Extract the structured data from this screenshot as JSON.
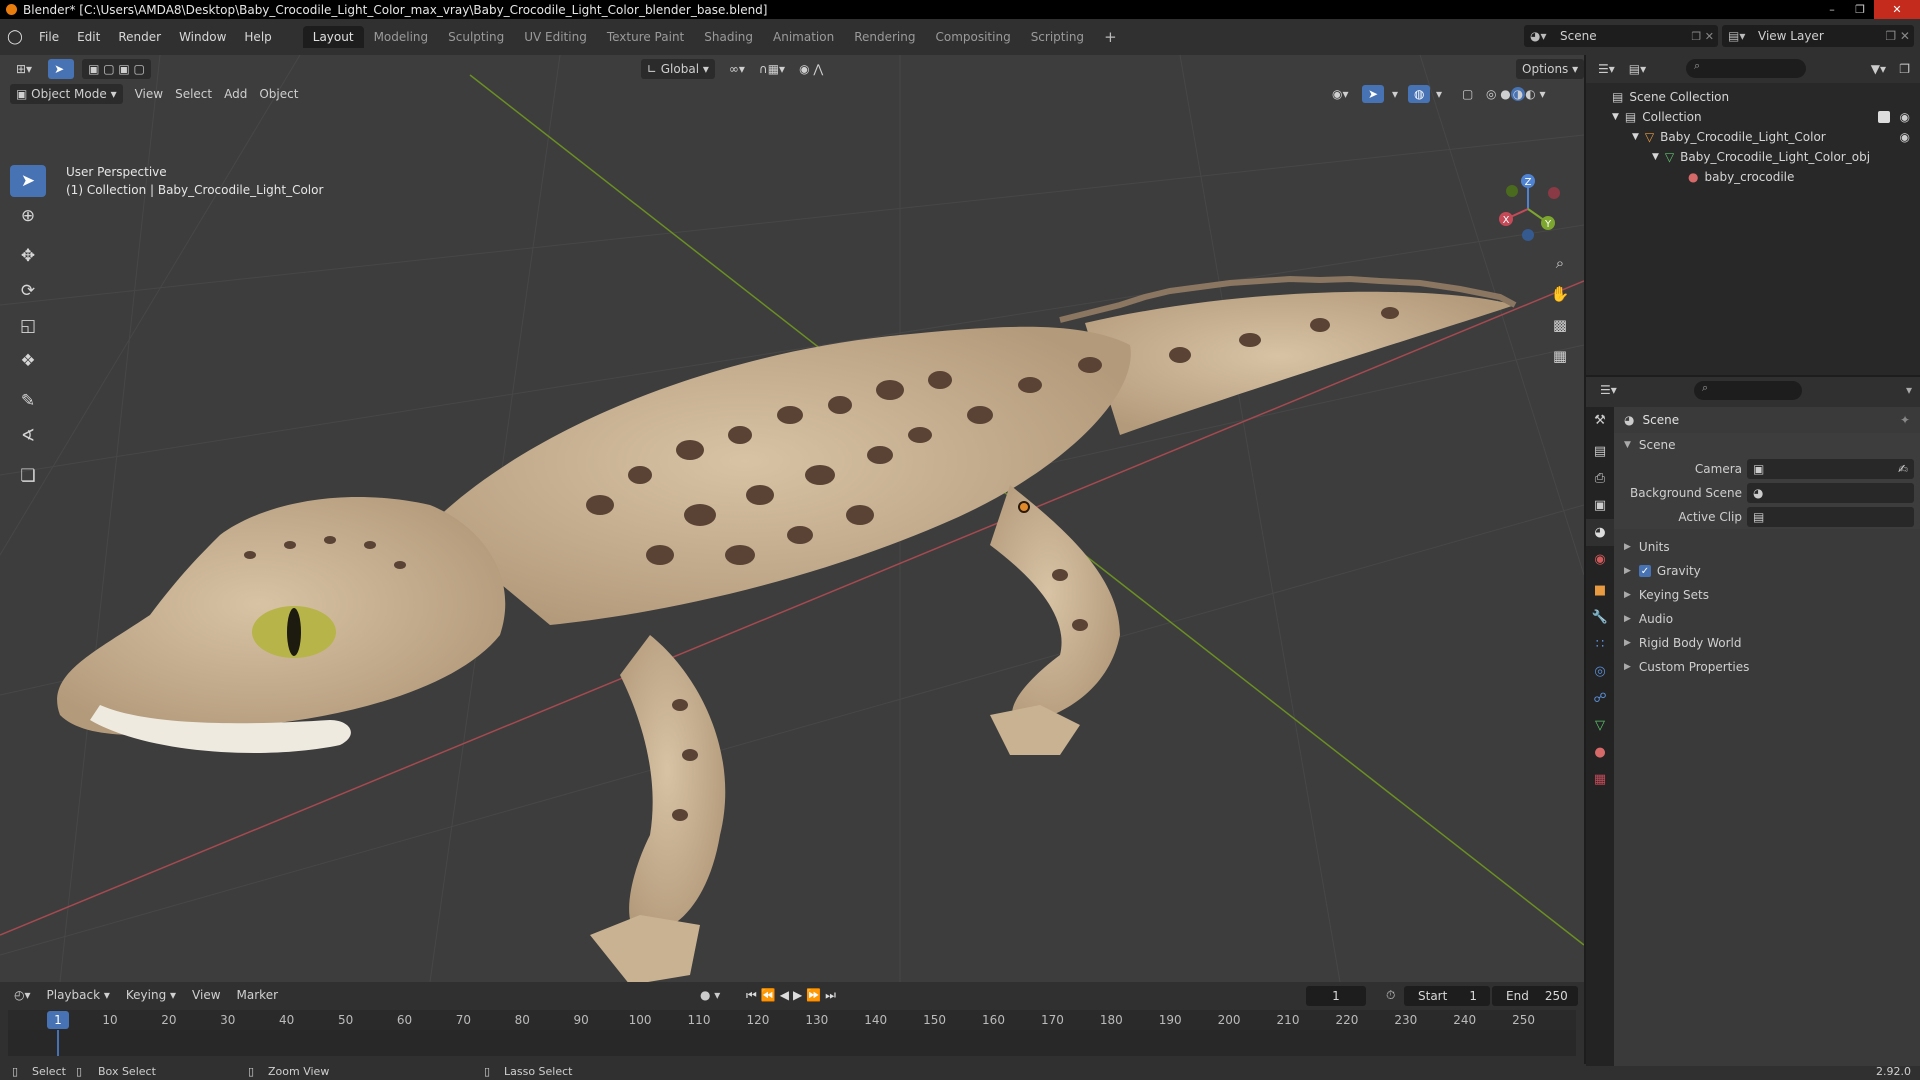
{
  "window": {
    "title": "Blender* [C:\\Users\\AMDA8\\Desktop\\Baby_Crocodile_Light_Color_max_vray\\Baby_Crocodile_Light_Color_blender_base.blend]"
  },
  "menu": {
    "file": "File",
    "edit": "Edit",
    "render": "Render",
    "window": "Window",
    "help": "Help"
  },
  "workspaces": [
    "Layout",
    "Modeling",
    "Sculpting",
    "UV Editing",
    "Texture Paint",
    "Shading",
    "Animation",
    "Rendering",
    "Compositing",
    "Scripting"
  ],
  "scene_selector": "Scene",
  "view_layer_selector": "View Layer",
  "viewport": {
    "mode": "Object Mode",
    "menus": [
      "View",
      "Select",
      "Add",
      "Object"
    ],
    "orientation": "Global",
    "options": "Options",
    "overlay_title": "User Perspective",
    "overlay_subtitle": "(1) Collection | Baby_Crocodile_Light_Color",
    "gizmo": {
      "x": "X",
      "y": "Y",
      "z": "Z"
    }
  },
  "timeline": {
    "menus": [
      "Playback",
      "Keying",
      "View",
      "Marker"
    ],
    "current_frame": "1",
    "start_label": "Start",
    "start_value": "1",
    "end_label": "End",
    "end_value": "250",
    "ruler_labels": [
      "10",
      "20",
      "30",
      "40",
      "50",
      "60",
      "70",
      "80",
      "90",
      "100",
      "110",
      "120",
      "130",
      "140",
      "150",
      "160",
      "170",
      "180",
      "190",
      "200",
      "210",
      "220",
      "230",
      "240",
      "250"
    ],
    "ruler_current": "1"
  },
  "statusbar": {
    "select": "Select",
    "box_select": "Box Select",
    "zoom_view": "Zoom View",
    "lasso_select": "Lasso Select",
    "version": "2.92.0"
  },
  "outliner": {
    "rows": [
      {
        "label": "Scene Collection",
        "icon": "scene-collection-icon"
      },
      {
        "label": "Collection",
        "icon": "collection-icon"
      },
      {
        "label": "Baby_Crocodile_Light_Color",
        "icon": "object-icon"
      },
      {
        "label": "Baby_Crocodile_Light_Color_obj",
        "icon": "mesh-icon"
      },
      {
        "label": "baby_crocodile",
        "icon": "material-icon"
      }
    ]
  },
  "properties": {
    "title": "Scene",
    "section": "Scene",
    "fields": [
      {
        "label": "Camera"
      },
      {
        "label": "Background Scene"
      },
      {
        "label": "Active Clip"
      }
    ],
    "subpanels": [
      "Units",
      "Gravity",
      "Keying Sets",
      "Audio",
      "Rigid Body World",
      "Custom Properties"
    ]
  },
  "colors": {
    "accent": "#4772b3",
    "x_axis": "#c44a58",
    "y_axis": "#7da62e",
    "z_axis": "#4f83d1",
    "viewport_bg": "#3d3d3d"
  }
}
